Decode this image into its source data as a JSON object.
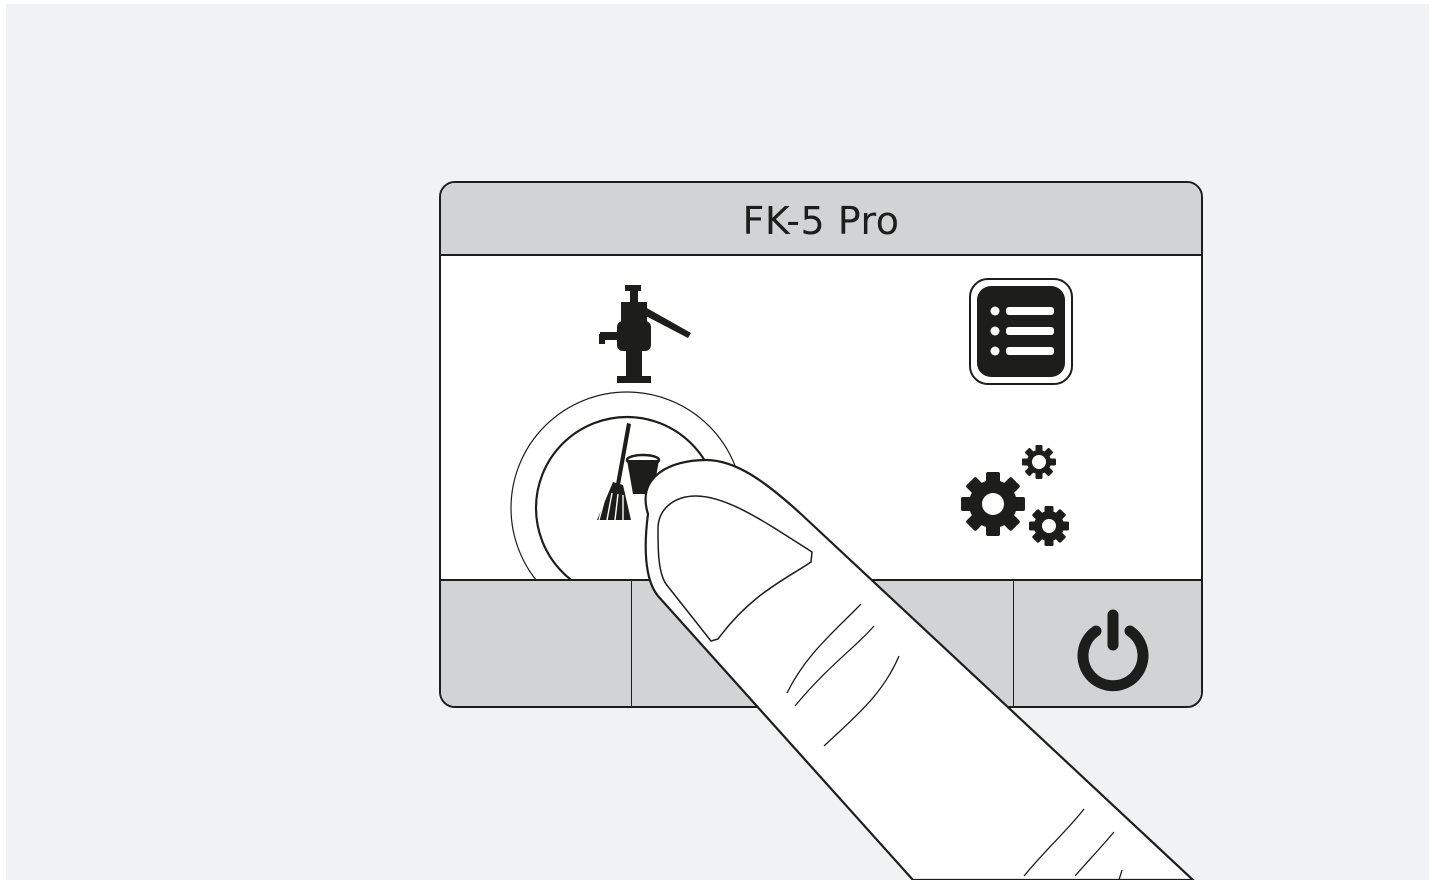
{
  "device": {
    "title": "FK-5 Pro"
  },
  "main_menu": {
    "items": [
      {
        "id": "water-tap",
        "icon": "water-tap-icon"
      },
      {
        "id": "menu-list",
        "icon": "list-menu-icon"
      },
      {
        "id": "cleaning",
        "icon": "broom-bucket-icon",
        "pressed": true
      },
      {
        "id": "settings",
        "icon": "gears-icon"
      }
    ]
  },
  "softkeys": {
    "power_icon": "power-icon"
  },
  "colors": {
    "background": "#f1f2f4",
    "bar_gray": "#d2d3d5",
    "ink": "#1d1d1b"
  }
}
